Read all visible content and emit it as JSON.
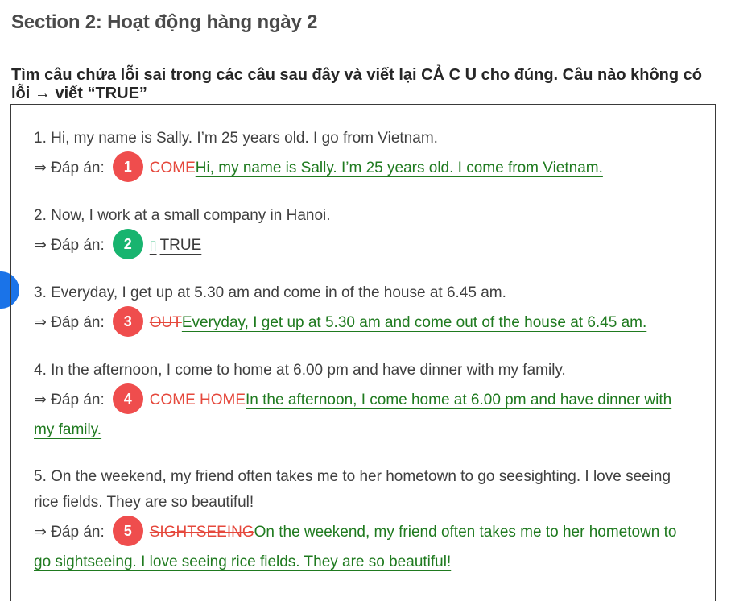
{
  "section_title": "Section 2: Hoạt động hàng ngày 2",
  "instruction": "Tìm câu chứa lỗi sai trong các câu sau đây và viết lại CẢ C U cho đúng. Câu nào không có lỗi → viết “TRUE”",
  "answer_prefix": "⇒ Đáp án:",
  "items": [
    {
      "question": "1. Hi, my name is Sally. I’m 25 years old. I go from Vietnam.",
      "badge": "1",
      "badge_color": "#ef4d4d",
      "wrong": "COME",
      "corrected": "Hi, my name is Sally. I’m 25 years old. I come from Vietnam."
    },
    {
      "question": "2. Now, I work at a small company in Hanoi.",
      "badge": "2",
      "badge_color": "#18b46f",
      "box_glyph": "▯",
      "corrected": "TRUE"
    },
    {
      "question": "3. Everyday, I get up at 5.30 am and come in of the house at 6.45 am.",
      "badge": "3",
      "badge_color": "#ef4d4d",
      "wrong": "OUT",
      "corrected": "Everyday, I get up at 5.30 am and come out of the house at 6.45 am."
    },
    {
      "question": "4. In the afternoon, I come to home at 6.00 pm and have dinner with my family.",
      "badge": "4",
      "badge_color": "#ef4d4d",
      "wrong": "COME HOME",
      "corrected": "In the afternoon, I come home at 6.00 pm and have dinner with my family."
    },
    {
      "question": "5. On the weekend, my friend often takes me to her hometown to go seesighting. I love seeing rice fields. They are so beautiful!",
      "badge": "5",
      "badge_color": "#ef4d4d",
      "wrong": "SIGHTSEEING",
      "corrected": "On the weekend, my friend often takes me to her hometown to go sightseeing. I love seeing rice fields. They are so beautiful!"
    }
  ]
}
